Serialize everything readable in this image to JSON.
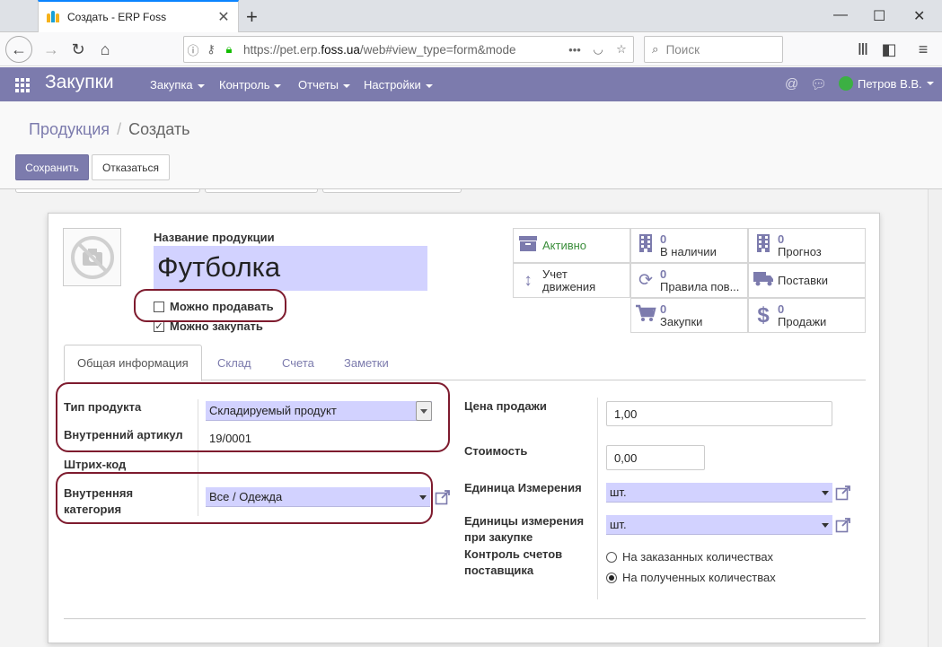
{
  "browser": {
    "tab_title": "Создать - ERP Foss",
    "url_prefix": "https://pet.erp.",
    "url_domain": "foss.ua",
    "url_suffix": "/web#view_type=form&mode",
    "search_placeholder": "Поиск"
  },
  "app": {
    "name": "Закупки",
    "menu": [
      "Закупка",
      "Контроль",
      "Отчеты",
      "Настройки"
    ],
    "user": "Петров В.В."
  },
  "breadcrumb": {
    "parent": "Продукция",
    "separator": "/",
    "current": "Создать"
  },
  "buttons": {
    "save": "Сохранить",
    "discard": "Отказаться"
  },
  "product": {
    "name_label": "Название продукции",
    "name": "Футболка",
    "can_sell": {
      "label": "Можно продавать",
      "checked": false
    },
    "can_buy": {
      "label": "Можно закупать",
      "checked": true
    }
  },
  "stat_buttons": [
    {
      "icon": "archive-icon",
      "value": "",
      "label": "Активно"
    },
    {
      "icon": "building-icon",
      "value": "0",
      "label": "В наличии"
    },
    {
      "icon": "building-icon",
      "value": "0",
      "label": "Прогноз"
    },
    {
      "icon": "arrows-vertical-icon",
      "value": "",
      "label": "Учет движения"
    },
    {
      "icon": "refresh-icon",
      "value": "0",
      "label": "Правила пов..."
    },
    {
      "icon": "truck-icon",
      "value": "",
      "label": "Поставки"
    },
    {
      "icon": "cart-icon",
      "value": "0",
      "label": "Закупки"
    },
    {
      "icon": "dollar-icon",
      "value": "0",
      "label": "Продажи"
    }
  ],
  "tabs": [
    "Общая информация",
    "Склад",
    "Счета",
    "Заметки"
  ],
  "left_fields": {
    "product_type_label": "Тип продукта",
    "product_type_value": "Складируемый продукт",
    "internal_ref_label": "Внутренний артикул",
    "internal_ref_value": "19/0001",
    "barcode_label": "Штрих-код",
    "category_label_1": "Внутренняя",
    "category_label_2": "категория",
    "category_value": "Все / Одежда"
  },
  "right_fields": {
    "sale_price_label": "Цена продажи",
    "sale_price_value": "1,00",
    "cost_label": "Стоимость",
    "cost_value": "0,00",
    "uom_label": "Единица Измерения",
    "uom_value": "шт.",
    "purchase_uom_label_1": "Единицы измерения",
    "purchase_uom_label_2": "при закупке",
    "purchase_uom_value": "шт.",
    "bill_control_label_1": "Контроль счетов",
    "bill_control_label_2": "поставщика",
    "bill_options": [
      {
        "label": "На заказанных количествах",
        "selected": false
      },
      {
        "label": "На полученных количествах",
        "selected": true
      }
    ]
  },
  "colors": {
    "accent": "#7c7bad",
    "input_highlight": "#d2d2ff",
    "annotation": "#7e1b2e",
    "active_green": "#3a8d3a"
  }
}
